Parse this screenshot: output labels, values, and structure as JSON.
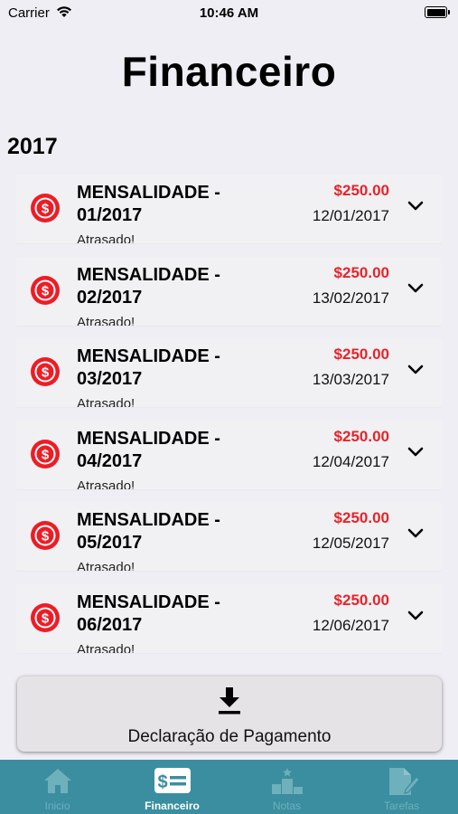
{
  "status_bar": {
    "carrier": "Carrier",
    "time": "10:46 AM"
  },
  "page_title": "Financeiro",
  "year": "2017",
  "payments": [
    {
      "title": "MENSALIDADE - 01/2017",
      "amount": "$250.00",
      "date": "12/01/2017",
      "status": "Atrasado!"
    },
    {
      "title": "MENSALIDADE - 02/2017",
      "amount": "$250.00",
      "date": "13/02/2017",
      "status": "Atrasado!"
    },
    {
      "title": "MENSALIDADE - 03/2017",
      "amount": "$250.00",
      "date": "13/03/2017",
      "status": "Atrasado!"
    },
    {
      "title": "MENSALIDADE - 04/2017",
      "amount": "$250.00",
      "date": "12/04/2017",
      "status": "Atrasado!"
    },
    {
      "title": "MENSALIDADE - 05/2017",
      "amount": "$250.00",
      "date": "12/05/2017",
      "status": "Atrasado!"
    },
    {
      "title": "MENSALIDADE - 06/2017",
      "amount": "$250.00",
      "date": "12/06/2017",
      "status": "Atrasado!"
    }
  ],
  "download_button": {
    "label": "Declaração de Pagamento",
    "icon": "download-icon"
  },
  "tabs": [
    {
      "label": "Inicio",
      "icon": "home-icon",
      "active": false
    },
    {
      "label": "Financeiro",
      "icon": "money-icon",
      "active": true
    },
    {
      "label": "Notas",
      "icon": "podium-icon",
      "active": false
    },
    {
      "label": "Tarefas",
      "icon": "document-edit-icon",
      "active": false
    }
  ],
  "colors": {
    "accent_red": "#e8232a",
    "tab_bar": "#3a8ea0",
    "background": "#efeef4"
  }
}
